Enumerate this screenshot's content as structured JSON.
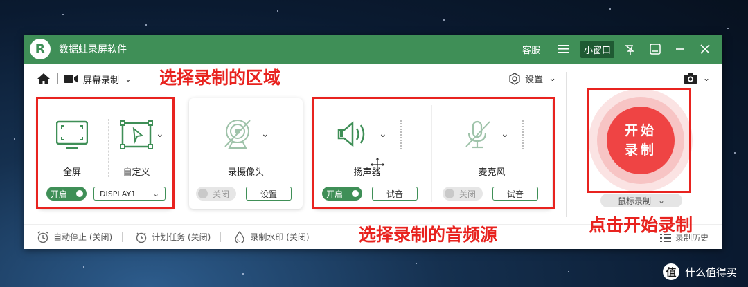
{
  "app": {
    "title": "数据蛙录屏软件",
    "logo_letter": "R"
  },
  "titlebar": {
    "service": "客服",
    "mini_window": "小窗口"
  },
  "toolbar": {
    "mode": "屏幕录制",
    "settings": "设置"
  },
  "screen_panel": {
    "fullscreen_label": "全屏",
    "custom_label": "自定义",
    "toggle": "开启",
    "display": "DISPLAY1"
  },
  "webcam_panel": {
    "label": "录摄像头",
    "toggle": "关闭",
    "settings": "设置"
  },
  "speaker_panel": {
    "label": "扬声器",
    "toggle": "开启",
    "test": "试音"
  },
  "mic_panel": {
    "label": "麦克风",
    "toggle": "关闭",
    "test": "试音"
  },
  "record": {
    "button_line1": "开始",
    "button_line2": "录制",
    "mode": "鼠标录制"
  },
  "bottom": {
    "auto_stop": "自动停止 (关闭)",
    "schedule": "计划任务 (关闭)",
    "watermark": "录制水印 (关闭)",
    "history": "录制历史"
  },
  "annotations": {
    "select_area": "选择录制的区域",
    "select_audio": "选择录制的音频源",
    "click_start": "点击开始录制"
  },
  "site_watermark": {
    "text": "什么值得买",
    "logo": "值"
  },
  "colors": {
    "brand_green": "#3f8f57",
    "record_red": "#ef4444",
    "annotation_red": "#e8231f"
  }
}
